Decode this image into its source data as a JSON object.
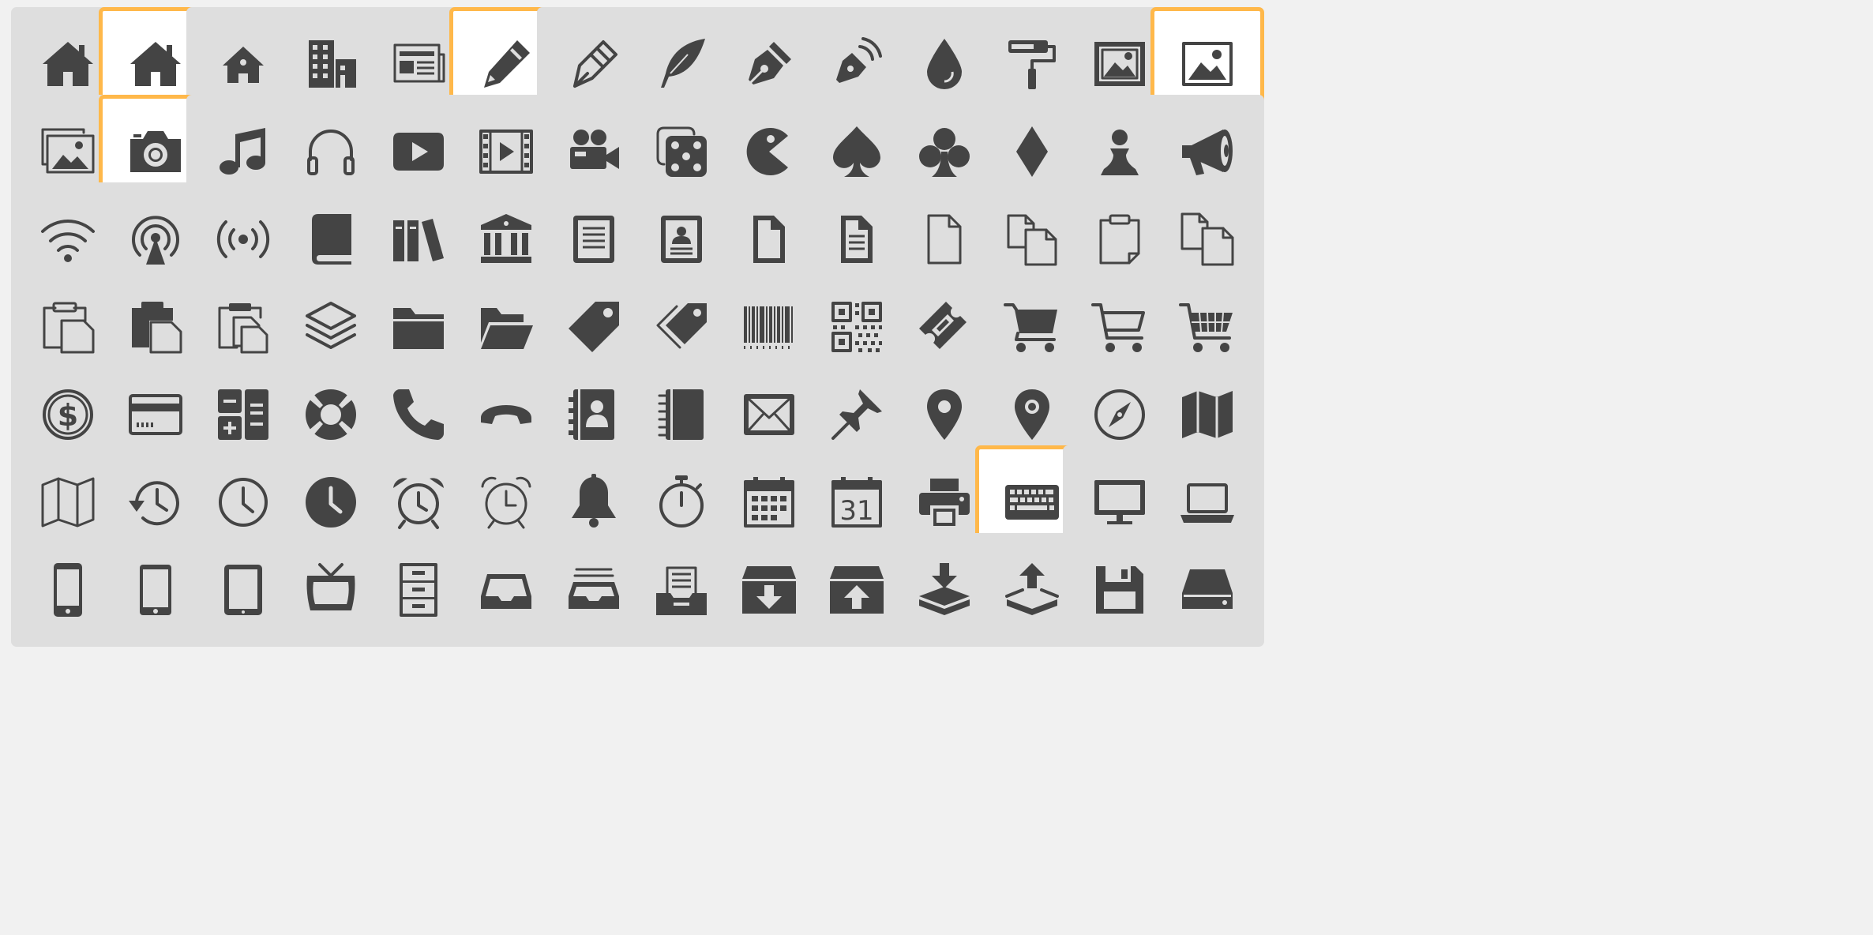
{
  "colors": {
    "page_background": "#f1f1f1",
    "tile_background": "#dedede",
    "selected_tile_background": "#ffffff",
    "selected_border": "#ffb84a",
    "icon_color": "#444444"
  },
  "icon_rows": [
    [
      "home-icon",
      "home-icon",
      "home-small-icon",
      "office-building-icon",
      "newspaper-icon",
      "pencil-icon",
      "pen-nib-icon",
      "feather-quill-icon",
      "fountain-pen-icon",
      "podcast-pen-icon",
      "droplet-icon",
      "paint-roller-icon",
      "image-framed-icon",
      "image-icon"
    ],
    [
      "images-stack-icon",
      "camera-icon",
      "music-note-icon",
      "headphones-icon",
      "video-play-icon",
      "film-icon",
      "video-camera-icon",
      "dice-icon",
      "pacman-icon",
      "spade-icon",
      "club-icon",
      "diamond-icon",
      "pawn-icon",
      "megaphone-icon"
    ],
    [
      "wifi-icon",
      "podcast-broadcast-icon",
      "radio-signal-icon",
      "book-icon",
      "books-library-icon",
      "bank-library-icon",
      "file-text-icon",
      "profile-card-icon",
      "file-empty-icon",
      "file-text-alt-icon",
      "file-outline-icon",
      "files-copy-icon",
      "clipboard-file-icon",
      "copy-files-icon"
    ],
    [
      "clipboard-paste-icon",
      "clipboard-paste-alt-icon",
      "clipboard-copy-icon",
      "stack-layers-icon",
      "folder-icon",
      "folder-open-icon",
      "price-tag-icon",
      "price-tags-icon",
      "barcode-icon",
      "qr-code-icon",
      "ticket-icon",
      "shopping-cart-icon",
      "cart-icon",
      "cart-basket-icon"
    ],
    [
      "coin-dollar-icon",
      "credit-card-icon",
      "calculator-icon",
      "lifebuoy-icon",
      "phone-icon",
      "phone-hang-up-icon",
      "address-book-icon",
      "notebook-icon",
      "envelope-icon",
      "pushpin-icon",
      "location-pin-icon",
      "location-pin-alt-icon",
      "compass-icon",
      "map-icon"
    ],
    [
      "map-outline-icon",
      "history-icon",
      "clock-icon",
      "clock-filled-icon",
      "alarm-clock-icon",
      "alarm-outline-icon",
      "bell-icon",
      "stopwatch-icon",
      "calendar-icon",
      "calendar-31-icon",
      "printer-icon",
      "keyboard-icon",
      "desktop-monitor-icon",
      "laptop-icon"
    ],
    [
      "mobile-phone-icon",
      "mobile-phone-alt-icon",
      "tablet-icon",
      "tv-icon",
      "drawer-cabinet-icon",
      "inbox-tray-icon",
      "inbox-stack-icon",
      "archive-box-icon",
      "box-add-icon",
      "box-remove-icon",
      "download-tray-icon",
      "upload-tray-icon",
      "floppy-disk-icon",
      "hard-drive-icon"
    ]
  ],
  "selected_icons": [
    "0-1",
    "0-5",
    "0-13",
    "1-1",
    "5-11"
  ]
}
